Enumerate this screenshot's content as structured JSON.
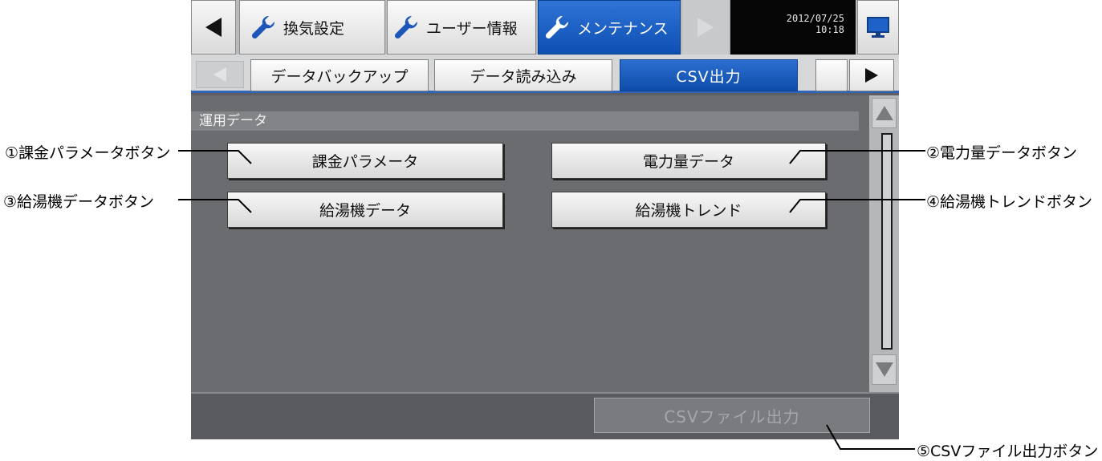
{
  "topbar": {
    "tabs": [
      {
        "label": "換気設定",
        "active": false
      },
      {
        "label": "ユーザー情報",
        "active": false
      },
      {
        "label": "メンテナンス",
        "active": true
      }
    ],
    "date": "2012/07/25",
    "time": "10:18"
  },
  "subtabs": [
    {
      "label": "データバックアップ",
      "active": false
    },
    {
      "label": "データ読み込み",
      "active": false
    },
    {
      "label": "CSV出力",
      "active": true
    }
  ],
  "section": {
    "title": "運用データ"
  },
  "buttons": {
    "billing_params": "課金パラメータ",
    "power_data": "電力量データ",
    "water_heater_data": "給湯機データ",
    "water_heater_trend": "給湯機トレンド"
  },
  "footer": {
    "csv_file_output": "CSVファイル出力"
  },
  "callouts": {
    "c1": "①課金パラメータボタン",
    "c2": "②電力量データボタン",
    "c3": "③給湯機データボタン",
    "c4": "④給湯機トレンドボタン",
    "c5": "⑤CSVファイル出力ボタン"
  },
  "colors": {
    "active_tab": "#1a5fc4",
    "screen_bg": "#6b6c6f",
    "header_bar": "#b9babc"
  },
  "icons": [
    "left-arrow-icon",
    "right-arrow-icon",
    "wrench-icon",
    "monitor-icon",
    "scroll-up-icon",
    "scroll-down-icon"
  ]
}
